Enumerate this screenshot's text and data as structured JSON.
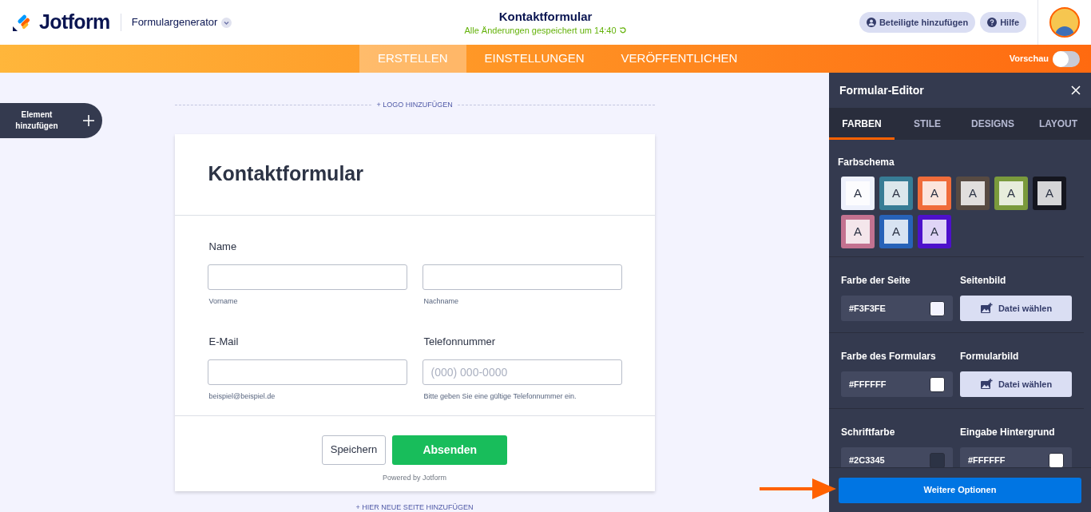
{
  "header": {
    "brand": "Jotform",
    "app_menu": "Formulargenerator",
    "form_title": "Kontaktformular",
    "save_status": "Alle Änderungen gespeichert um 14:40",
    "buttons": [
      {
        "kind": "person",
        "label": "Beteiligte hinzufügen"
      },
      {
        "kind": "help",
        "label": "Hilfe"
      }
    ]
  },
  "nav": {
    "tabs": [
      {
        "label": "ERSTELLEN",
        "selected": true
      },
      {
        "label": "EINSTELLUNGEN",
        "selected": false
      },
      {
        "label": "VERÖFFENTLICHEN",
        "selected": false
      }
    ],
    "preview": {
      "label": "Vorschau",
      "on": false
    }
  },
  "add_element": {
    "label": "Element hinzufügen"
  },
  "canvas": {
    "add_logo": "+ LOGO HINZUFÜGEN",
    "add_page": "+ HIER NEUE SEITE HINZUFÜGEN"
  },
  "form": {
    "title": "Kontaktformular",
    "rows": [
      [
        {
          "label": "Name",
          "sublabel": "Vorname"
        },
        {
          "sublabel": "Nachname"
        }
      ],
      [
        {
          "label": "E-Mail",
          "sublabel": "beispiel@beispiel.de"
        },
        {
          "label": "Telefonnummer",
          "placeholder": "(000) 000-0000",
          "sublabel": "Bitte geben Sie eine gültige Telefonnummer ein."
        }
      ]
    ],
    "buttons": [
      {
        "kind": "secondary",
        "label": "Speichern"
      },
      {
        "kind": "primary",
        "label": "Absenden"
      }
    ],
    "footer": "Powered by Jotform"
  },
  "editor": {
    "title": "Formular-Editor",
    "tabs": [
      {
        "label": "FARBEN",
        "selected": true
      },
      {
        "label": "STILE",
        "selected": false
      },
      {
        "label": "DESIGNS",
        "selected": false
      },
      {
        "label": "LAYOUT",
        "selected": false
      }
    ],
    "scheme_label": "Farbschema",
    "schemes": [
      {
        "letter": "A",
        "color": "#eef1fc"
      },
      {
        "letter": "A",
        "color": "#377c95"
      },
      {
        "letter": "A",
        "color": "#f06c3a"
      },
      {
        "letter": "A",
        "color": "#574a42"
      },
      {
        "letter": "A",
        "color": "#7a9a3c"
      },
      {
        "letter": "A",
        "color": "#15161f"
      },
      {
        "letter": "A",
        "color": "#c37290"
      },
      {
        "letter": "A",
        "color": "#2762b8"
      },
      {
        "letter": "A",
        "color": "#4d10cb"
      }
    ],
    "settings": [
      [
        {
          "kind": "color",
          "label": "Farbe der Seite",
          "value": "#F3F3FE"
        },
        {
          "kind": "image",
          "label": "Seitenbild",
          "button": "Datei wählen"
        }
      ],
      [
        {
          "kind": "color",
          "label": "Farbe des Formulars",
          "value": "#FFFFFF"
        },
        {
          "kind": "image",
          "label": "Formularbild",
          "button": "Datei wählen"
        }
      ],
      [
        {
          "kind": "color",
          "label": "Schriftfarbe",
          "value": "#2C3345"
        },
        {
          "kind": "color",
          "label": "Eingabe Hintergrund",
          "value": "#FFFFFF"
        }
      ]
    ],
    "more_button": "Weitere Optionen"
  }
}
